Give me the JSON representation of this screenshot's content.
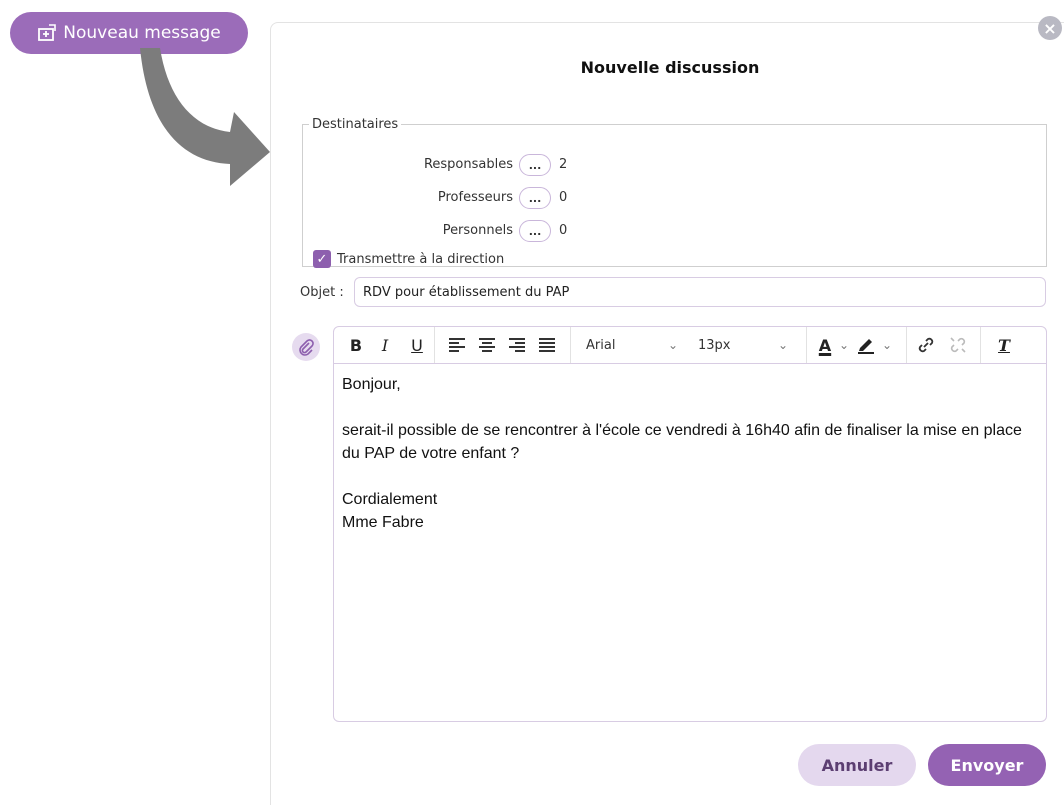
{
  "launcher": {
    "label": "Nouveau message",
    "icon": "compose-icon"
  },
  "dialog": {
    "title": "Nouvelle discussion",
    "close_icon": "close-icon",
    "recipients": {
      "legend": "Destinataires",
      "rows": [
        {
          "label": "Responsables",
          "button": "...",
          "count": "2"
        },
        {
          "label": "Professeurs",
          "button": "...",
          "count": "0"
        },
        {
          "label": "Personnels",
          "button": "...",
          "count": "0"
        }
      ],
      "forward_label": "Transmettre à la direction",
      "forward_checked": true
    },
    "subject": {
      "label": "Objet :",
      "value": "RDV pour établissement du PAP"
    },
    "toolbar": {
      "bold": "B",
      "italic": "I",
      "underline": "U",
      "font": "Arial",
      "size": "13px",
      "text_color": "A",
      "clear_format": "T"
    },
    "body": [
      "Bonjour,",
      "",
      "serait-il possible de se rencontrer à l'école ce vendredi à 16h40 afin de finaliser la mise en place du PAP de votre enfant ?",
      "",
      "Cordialement",
      "Mme Fabre"
    ],
    "buttons": {
      "cancel": "Annuler",
      "send": "Envoyer"
    }
  },
  "colors": {
    "accent": "#9b6cb9",
    "accent_light": "#e4d8ee"
  }
}
